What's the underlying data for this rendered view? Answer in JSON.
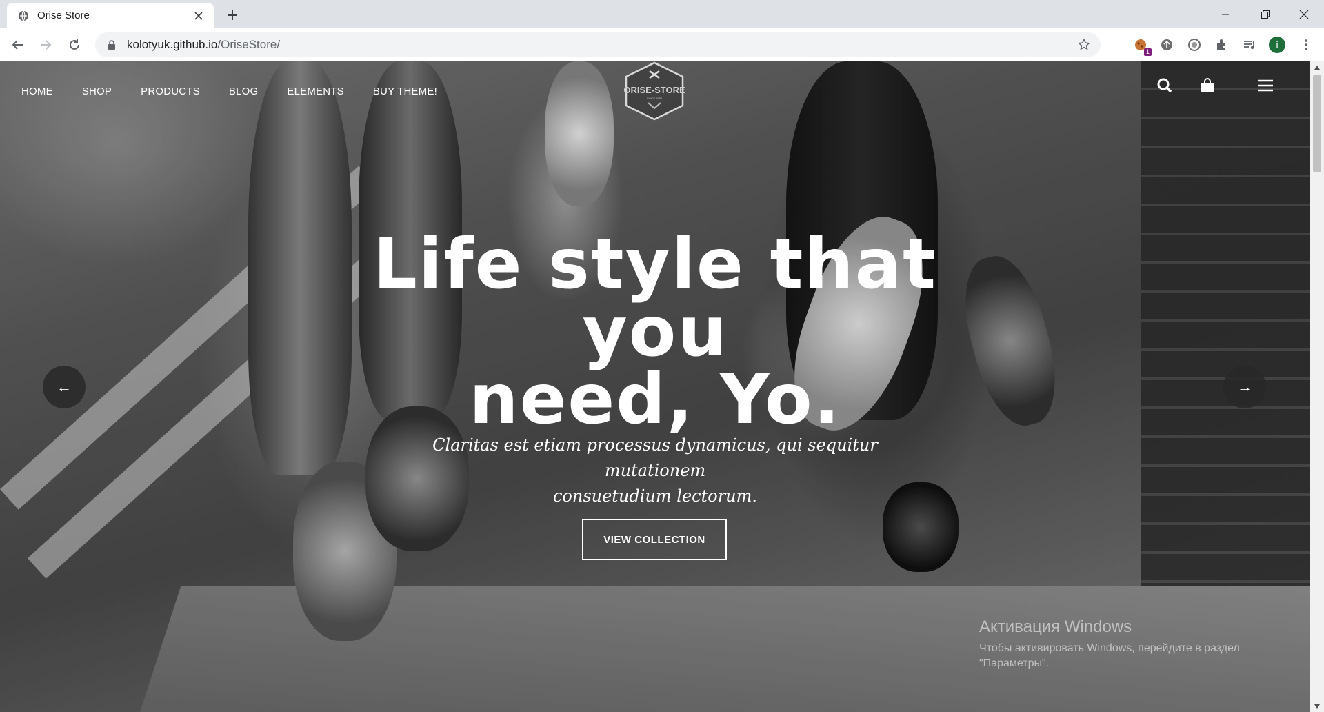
{
  "browser": {
    "tab_title": "Orise Store",
    "url_host": "kolotyuk.github.io",
    "url_path": "/OriseStore/",
    "profile_initial": "i",
    "extension_badge": "1"
  },
  "site": {
    "nav": [
      "HOME",
      "SHOP",
      "PRODUCTS",
      "BLOG",
      "ELEMENTS",
      "BUY THEME!"
    ],
    "logo_name": "ORISE-STORE",
    "logo_since": "SINCE 1982"
  },
  "hero": {
    "title_line1": "Life style that you",
    "title_line2": "need, Yo.",
    "subtitle_line1": "Claritas est etiam processus dynamicus, qui sequitur mutationem",
    "subtitle_line2": "consuetudium lectorum.",
    "button": "VIEW COLLECTION",
    "prev_arrow": "←",
    "next_arrow": "→"
  },
  "watermark": {
    "title": "Активация Windows",
    "text": "Чтобы активировать Windows, перейдите в раздел \"Параметры\"."
  },
  "colors": {
    "tabbar_bg": "#dee1e6",
    "profile_bg": "#1e6e3a",
    "badge_bg": "#7c1f7c"
  }
}
